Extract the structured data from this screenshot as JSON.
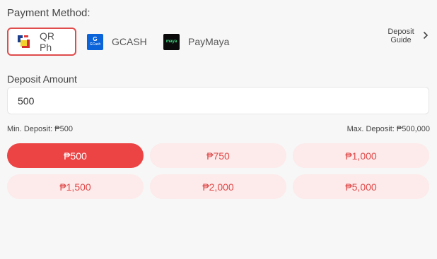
{
  "payment": {
    "title": "Payment Method:",
    "methods": [
      {
        "label": "QR Ph",
        "selected": true
      },
      {
        "label": "GCASH",
        "logo_text": "G",
        "logo_sub": "GCash"
      },
      {
        "label": "PayMaya",
        "logo_text": "maya"
      }
    ],
    "guide": {
      "label": "Deposit Guide"
    }
  },
  "deposit": {
    "label": "Deposit Amount",
    "value": "500",
    "min": "Min. Deposit: ₱500",
    "max": "Max. Deposit: ₱500,000"
  },
  "chips": [
    "₱500",
    "₱750",
    "₱1,000",
    "₱1,500",
    "₱2,000",
    "₱5,000"
  ],
  "colors": {
    "accent": "#ec4444",
    "chip_bg": "#fdeaea",
    "gcash_blue": "#0a63d8",
    "maya_green": "#3ddc84"
  }
}
